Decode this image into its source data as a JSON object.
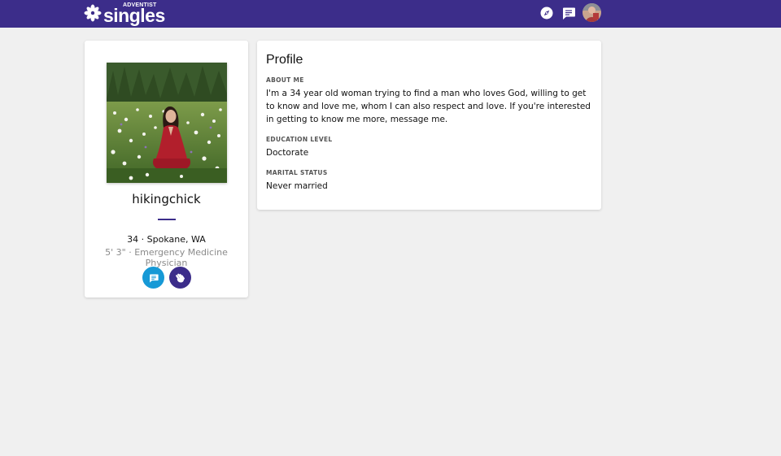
{
  "brand": {
    "small": "ADVENTIST",
    "big": "singles",
    "primary_color": "#3c2d8a",
    "message_color": "#1699d6"
  },
  "nav": {
    "explore_icon": "compass-icon",
    "messages_icon": "chat-icon",
    "avatar": "user-avatar"
  },
  "member": {
    "username": "hikingchick",
    "location_line": "34 · Spokane, WA",
    "details_line": "5' 3\" · Emergency Medicine Physician",
    "message_icon": "chat-icon",
    "wave_icon": "wave-hand-icon"
  },
  "profile": {
    "title": "Profile",
    "about_label": "ABOUT ME",
    "about_text": "I'm a 34 year old woman trying to find a man who loves God, willing to get to know and love me, whom I can also respect and love. If you're interested in getting to know me more, message me.",
    "education_label": "EDUCATION LEVEL",
    "education_value": "Doctorate",
    "marital_label": "MARITAL STATUS",
    "marital_value": "Never married"
  }
}
